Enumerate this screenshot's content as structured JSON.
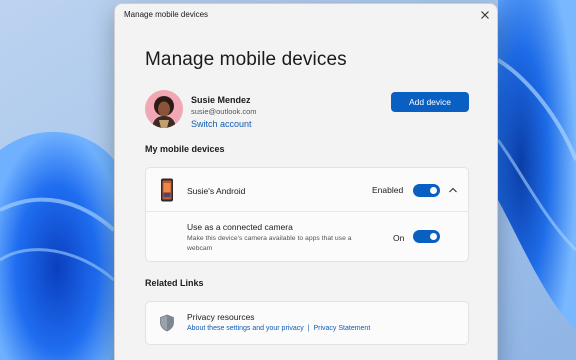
{
  "window": {
    "title": "Manage mobile devices"
  },
  "page": {
    "heading": "Manage mobile devices"
  },
  "account": {
    "name": "Susie Mendez",
    "email": "susie@outlook.com",
    "switch_label": "Switch account"
  },
  "add_device_label": "Add device",
  "devices_section": {
    "heading": "My mobile devices",
    "device": {
      "name": "Susie's Android",
      "status_label": "Enabled",
      "enabled": true,
      "camera": {
        "title": "Use as a connected camera",
        "description": "Make this device's camera available to apps that use a webcam",
        "state_label": "On",
        "enabled": true
      }
    }
  },
  "links_section": {
    "heading": "Related Links",
    "privacy": {
      "title": "Privacy resources",
      "link1": "About these settings and your privacy",
      "separator": "|",
      "link2": "Privacy Statement"
    }
  },
  "icons": {
    "close": "close-icon",
    "phone": "phone-icon",
    "chevron": "chevron-up-icon",
    "shield": "shield-icon"
  },
  "colors": {
    "accent": "#0a5fc2",
    "link": "#0f5bb5",
    "dialog_bg": "#f3f3f3"
  }
}
